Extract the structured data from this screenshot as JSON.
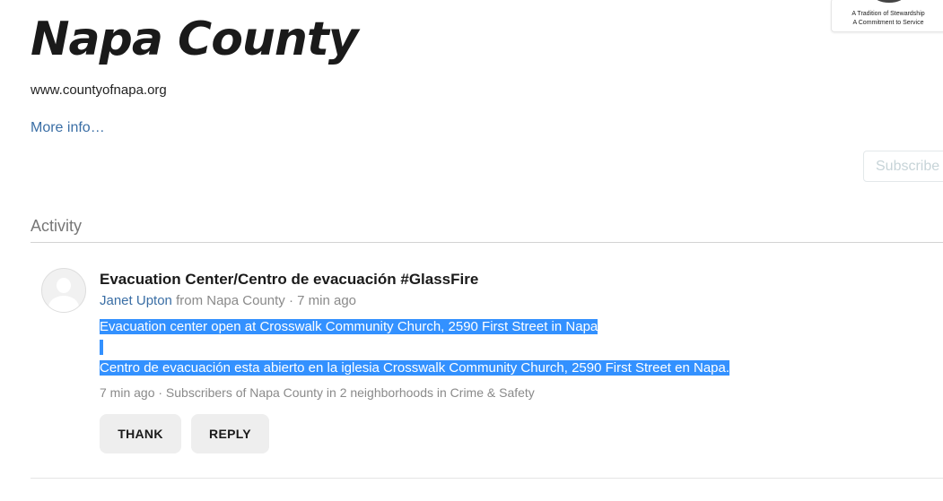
{
  "header": {
    "title": "Napa County",
    "website": "www.countyofnapa.org",
    "more_info": "More info…",
    "subscribe_label": "Subscribe",
    "logo": {
      "line1": "A Tradition of Stewardship",
      "line2": "A Commitment to Service"
    }
  },
  "activity": {
    "heading": "Activity",
    "post": {
      "title": "Evacuation Center/Centro de evacuación #GlassFire",
      "author": "Janet Upton",
      "from_text": "from Napa County",
      "separator": "·",
      "time": "7 min ago",
      "body_lines": [
        "Evacuation center open at Crosswalk Community Church, 2590 First Street in Napa",
        " ",
        "Centro de evacuación esta abierto en la iglesia Crosswalk Community Church, 2590 First Street en Napa."
      ],
      "footer": "7 min ago · Subscribers of Napa County in 2 neighborhoods in Crime & Safety",
      "thank_label": "THANK",
      "reply_label": "REPLY"
    }
  },
  "colors": {
    "link": "#3a6ea5",
    "selection": "#3391ff",
    "button_bg": "#eeeeee",
    "muted_text": "#8a8a8a"
  },
  "icons": {
    "avatar": "default-user-avatar-icon",
    "logo": "county-seal-logo"
  }
}
